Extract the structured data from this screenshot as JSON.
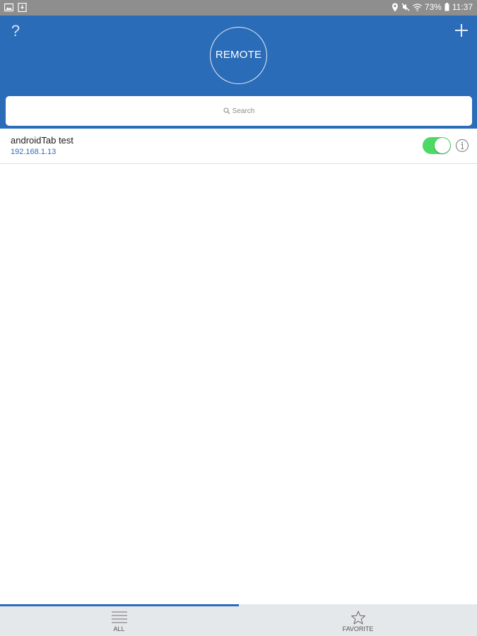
{
  "status_bar": {
    "battery": "73%",
    "time": "11:37"
  },
  "header": {
    "help_label": "?",
    "logo_text": "REMOTE",
    "search_placeholder": "Search"
  },
  "devices": [
    {
      "name": "androidTab test",
      "ip": "192.168.1.13",
      "enabled": true
    }
  ],
  "tabs": [
    {
      "label": "ALL",
      "selected": true
    },
    {
      "label": "FAVORITE",
      "selected": false
    }
  ],
  "colors": {
    "accent": "#2b6cb8",
    "toggle_on": "#4cd964",
    "status_bar": "#8e8e8e"
  }
}
